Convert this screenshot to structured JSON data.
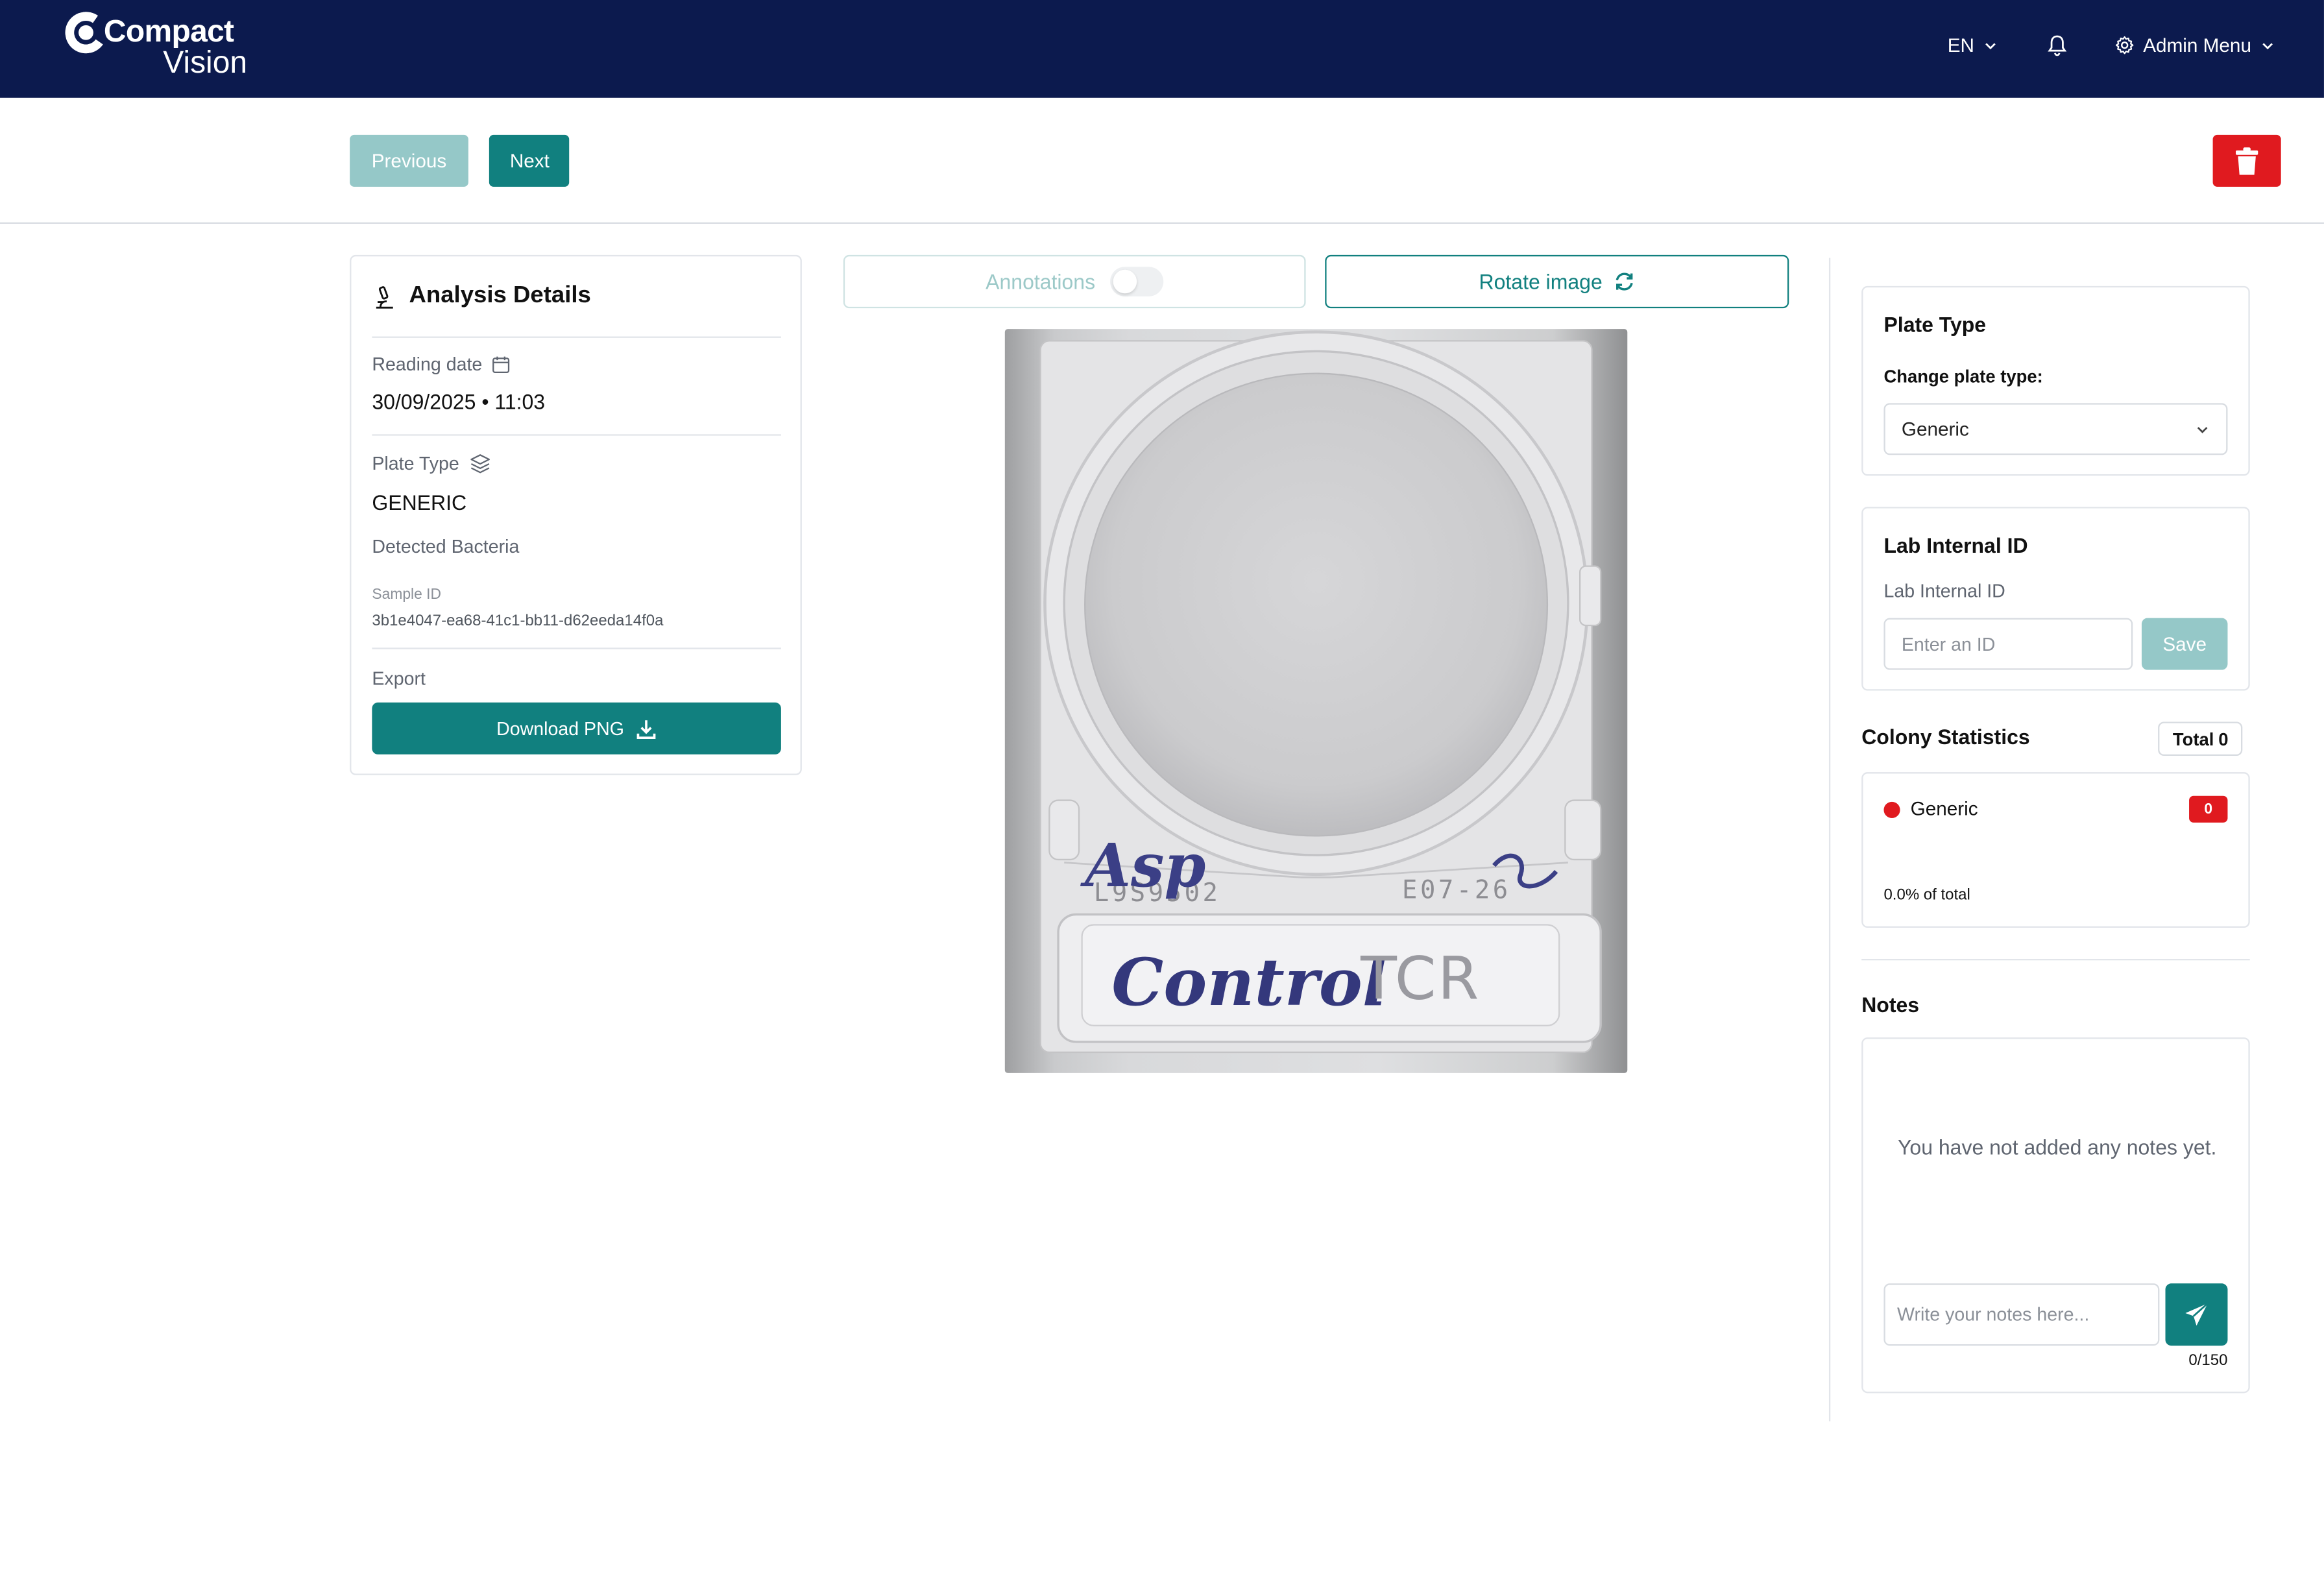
{
  "header": {
    "logo_line1": "Compact",
    "logo_line2": "Vision",
    "language": "EN",
    "admin_menu": "Admin Menu"
  },
  "toolbar": {
    "previous_label": "Previous",
    "next_label": "Next"
  },
  "analysis": {
    "title": "Analysis Details",
    "reading_date_label": "Reading date",
    "reading_date_value": "30/09/2025 • 11:03",
    "plate_type_label": "Plate Type",
    "plate_type_value": "GENERIC",
    "detected_bacteria_label": "Detected Bacteria",
    "sample_id_label": "Sample ID",
    "sample_id_value": "3b1e4047-ea68-41c1-bb11-d62eeda14f0a",
    "export_label": "Export",
    "download_label": "Download PNG"
  },
  "viewer": {
    "annotations_label": "Annotations",
    "annotations_enabled": false,
    "rotate_label": "Rotate image",
    "plate_handwriting_1": "Asp",
    "plate_handwriting_2": "Control",
    "plate_printed_text": "TCR",
    "plate_code_left": "L9S9502",
    "plate_code_right": "E07-26"
  },
  "plate_type_panel": {
    "title": "Plate Type",
    "change_label": "Change plate type:",
    "selected": "Generic"
  },
  "lab_id_panel": {
    "title": "Lab Internal ID",
    "field_label": "Lab Internal ID",
    "placeholder": "Enter an ID",
    "save_label": "Save"
  },
  "colony_stats": {
    "title": "Colony Statistics",
    "total_label": "Total",
    "total_value": "0",
    "items": [
      {
        "name": "Generic",
        "count": "0",
        "percent": "0.0% of total",
        "color": "#e01a1f"
      }
    ]
  },
  "notes": {
    "title": "Notes",
    "empty_message": "You have not added any notes yet.",
    "placeholder": "Write your notes here...",
    "counter": "0/150"
  },
  "colors": {
    "header_bg": "#0c1a4e",
    "accent": "#11807f",
    "accent_disabled": "#95c8c8",
    "danger": "#e01a1f"
  }
}
